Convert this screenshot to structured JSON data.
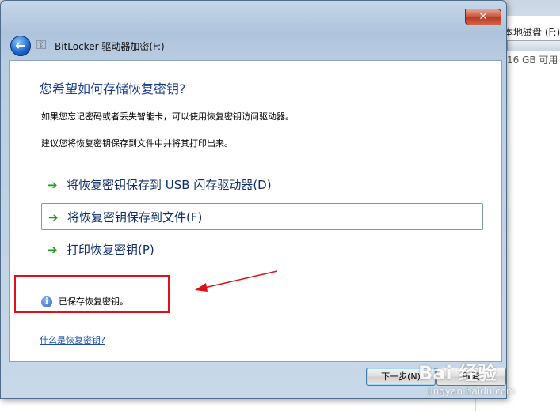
{
  "background": {
    "drive_title": "本地磁盘 (F:)",
    "drive_free": "16 GB 可用"
  },
  "window": {
    "title": "BitLocker 驱动器加密(F:)",
    "close_glyph": "✕",
    "back_glyph": "←"
  },
  "content": {
    "heading": "您希望如何存储恢复密钥?",
    "para1": "如果您忘记密码或者丢失智能卡，可以使用恢复密钥访问驱动器。",
    "para2": "建议您将恢复密钥保存到文件中并将其打印出来。",
    "options": [
      {
        "label": "将恢复密钥保存到 USB 闪存驱动器(D)"
      },
      {
        "label": "将恢复密钥保存到文件(F)"
      },
      {
        "label": "打印恢复密钥(P)"
      }
    ],
    "status": "已保存恢复密钥。",
    "help_link": "什么是恢复密钥?"
  },
  "buttons": {
    "next": "下一步(N)",
    "cancel": "取消"
  },
  "watermark": {
    "main": "Bai 经验",
    "sub": "jingyan.baidu.com"
  },
  "colors": {
    "heading": "#1c3f95",
    "annotation_red": "#e0101a",
    "arrow_green": "#1d9a1d"
  },
  "icons": {
    "title_icon": "bitlocker-key-icon",
    "status_icon": "info-icon",
    "option_icon": "green-arrow-icon"
  }
}
